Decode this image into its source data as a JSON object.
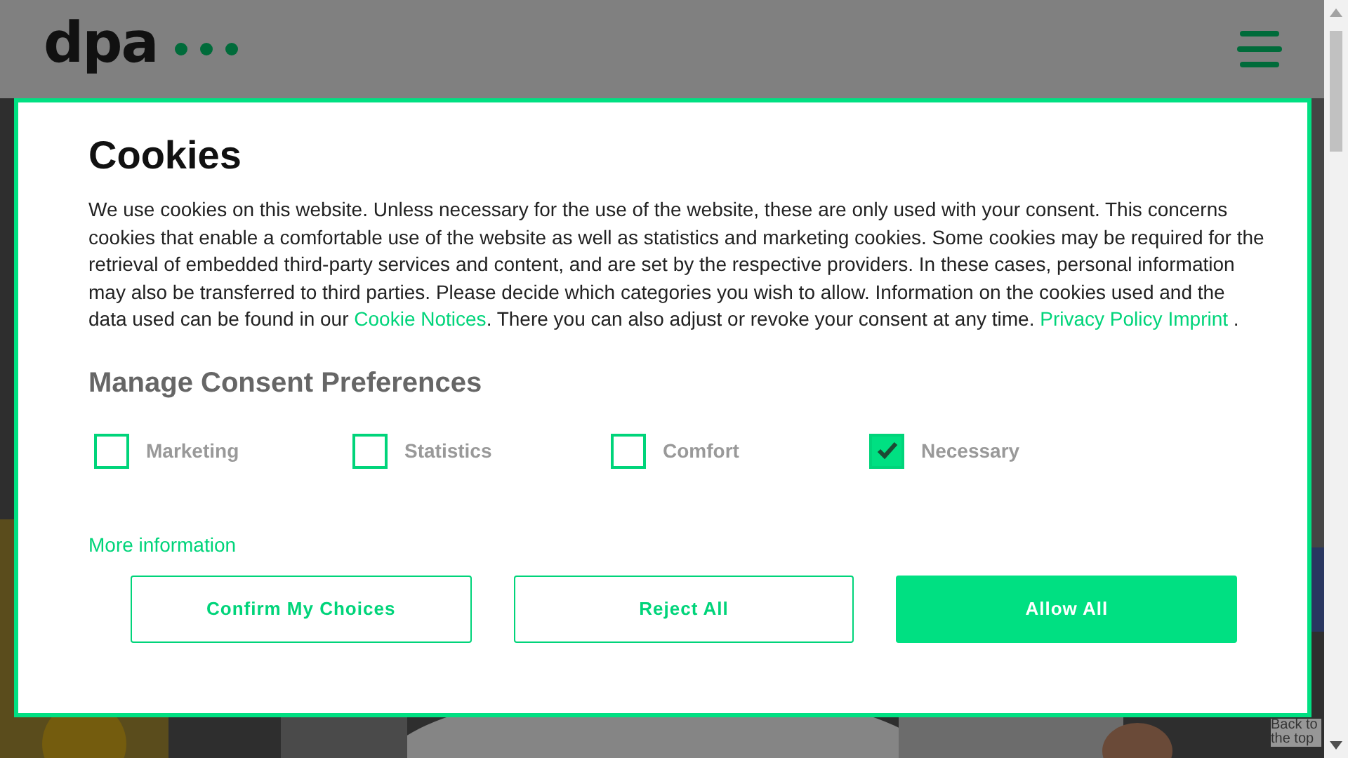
{
  "header": {
    "logo": "dpa"
  },
  "cookie_dialog": {
    "title": "Cookies",
    "intro": [
      {
        "kind": "text",
        "text": "We use cookies on this website. Unless necessary for the use of the website, these are only used with your consent. This concerns cookies that enable a comfortable use of the website as well as statistics and marketing cookies. Some cookies may be required for the retrieval of embedded third-party services and content, and are set by the respective providers. In these cases, personal information may also be transferred to third parties. Please decide which categories you wish to allow. Information on the cookies used and the data used can be found in our "
      },
      {
        "kind": "link",
        "text": "Cookie Notices"
      },
      {
        "kind": "text",
        "text": ". There you can also adjust or revoke your consent at any time. "
      },
      {
        "kind": "link",
        "text": "Privacy Policy"
      },
      {
        "kind": "link",
        "text": "Imprint"
      },
      {
        "kind": "text",
        "text": " ."
      }
    ],
    "preferences_heading": "Manage Consent Preferences",
    "options": [
      {
        "label": "Marketing",
        "checked": false
      },
      {
        "label": "Statistics",
        "checked": false
      },
      {
        "label": "Comfort",
        "checked": false
      },
      {
        "label": "Necessary",
        "checked": true
      }
    ],
    "more_link": "More information",
    "buttons": [
      {
        "label": "Confirm My Choices",
        "kind": "outline"
      },
      {
        "label": "Reject All",
        "kind": "outline"
      },
      {
        "label": "Allow All",
        "kind": "primary"
      }
    ]
  },
  "back_to_top": "Back to the top"
}
